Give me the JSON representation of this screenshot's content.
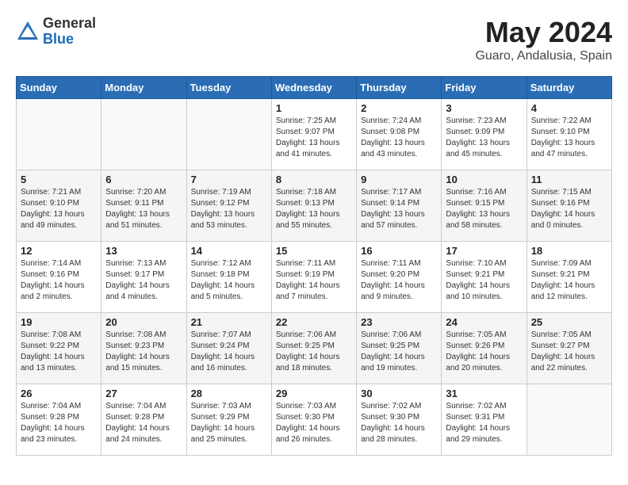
{
  "header": {
    "logo_general": "General",
    "logo_blue": "Blue",
    "month_title": "May 2024",
    "location": "Guaro, Andalusia, Spain"
  },
  "days_of_week": [
    "Sunday",
    "Monday",
    "Tuesday",
    "Wednesday",
    "Thursday",
    "Friday",
    "Saturday"
  ],
  "weeks": [
    [
      {
        "day": "",
        "info": ""
      },
      {
        "day": "",
        "info": ""
      },
      {
        "day": "",
        "info": ""
      },
      {
        "day": "1",
        "info": "Sunrise: 7:25 AM\nSunset: 9:07 PM\nDaylight: 13 hours\nand 41 minutes."
      },
      {
        "day": "2",
        "info": "Sunrise: 7:24 AM\nSunset: 9:08 PM\nDaylight: 13 hours\nand 43 minutes."
      },
      {
        "day": "3",
        "info": "Sunrise: 7:23 AM\nSunset: 9:09 PM\nDaylight: 13 hours\nand 45 minutes."
      },
      {
        "day": "4",
        "info": "Sunrise: 7:22 AM\nSunset: 9:10 PM\nDaylight: 13 hours\nand 47 minutes."
      }
    ],
    [
      {
        "day": "5",
        "info": "Sunrise: 7:21 AM\nSunset: 9:10 PM\nDaylight: 13 hours\nand 49 minutes."
      },
      {
        "day": "6",
        "info": "Sunrise: 7:20 AM\nSunset: 9:11 PM\nDaylight: 13 hours\nand 51 minutes."
      },
      {
        "day": "7",
        "info": "Sunrise: 7:19 AM\nSunset: 9:12 PM\nDaylight: 13 hours\nand 53 minutes."
      },
      {
        "day": "8",
        "info": "Sunrise: 7:18 AM\nSunset: 9:13 PM\nDaylight: 13 hours\nand 55 minutes."
      },
      {
        "day": "9",
        "info": "Sunrise: 7:17 AM\nSunset: 9:14 PM\nDaylight: 13 hours\nand 57 minutes."
      },
      {
        "day": "10",
        "info": "Sunrise: 7:16 AM\nSunset: 9:15 PM\nDaylight: 13 hours\nand 58 minutes."
      },
      {
        "day": "11",
        "info": "Sunrise: 7:15 AM\nSunset: 9:16 PM\nDaylight: 14 hours\nand 0 minutes."
      }
    ],
    [
      {
        "day": "12",
        "info": "Sunrise: 7:14 AM\nSunset: 9:16 PM\nDaylight: 14 hours\nand 2 minutes."
      },
      {
        "day": "13",
        "info": "Sunrise: 7:13 AM\nSunset: 9:17 PM\nDaylight: 14 hours\nand 4 minutes."
      },
      {
        "day": "14",
        "info": "Sunrise: 7:12 AM\nSunset: 9:18 PM\nDaylight: 14 hours\nand 5 minutes."
      },
      {
        "day": "15",
        "info": "Sunrise: 7:11 AM\nSunset: 9:19 PM\nDaylight: 14 hours\nand 7 minutes."
      },
      {
        "day": "16",
        "info": "Sunrise: 7:11 AM\nSunset: 9:20 PM\nDaylight: 14 hours\nand 9 minutes."
      },
      {
        "day": "17",
        "info": "Sunrise: 7:10 AM\nSunset: 9:21 PM\nDaylight: 14 hours\nand 10 minutes."
      },
      {
        "day": "18",
        "info": "Sunrise: 7:09 AM\nSunset: 9:21 PM\nDaylight: 14 hours\nand 12 minutes."
      }
    ],
    [
      {
        "day": "19",
        "info": "Sunrise: 7:08 AM\nSunset: 9:22 PM\nDaylight: 14 hours\nand 13 minutes."
      },
      {
        "day": "20",
        "info": "Sunrise: 7:08 AM\nSunset: 9:23 PM\nDaylight: 14 hours\nand 15 minutes."
      },
      {
        "day": "21",
        "info": "Sunrise: 7:07 AM\nSunset: 9:24 PM\nDaylight: 14 hours\nand 16 minutes."
      },
      {
        "day": "22",
        "info": "Sunrise: 7:06 AM\nSunset: 9:25 PM\nDaylight: 14 hours\nand 18 minutes."
      },
      {
        "day": "23",
        "info": "Sunrise: 7:06 AM\nSunset: 9:25 PM\nDaylight: 14 hours\nand 19 minutes."
      },
      {
        "day": "24",
        "info": "Sunrise: 7:05 AM\nSunset: 9:26 PM\nDaylight: 14 hours\nand 20 minutes."
      },
      {
        "day": "25",
        "info": "Sunrise: 7:05 AM\nSunset: 9:27 PM\nDaylight: 14 hours\nand 22 minutes."
      }
    ],
    [
      {
        "day": "26",
        "info": "Sunrise: 7:04 AM\nSunset: 9:28 PM\nDaylight: 14 hours\nand 23 minutes."
      },
      {
        "day": "27",
        "info": "Sunrise: 7:04 AM\nSunset: 9:28 PM\nDaylight: 14 hours\nand 24 minutes."
      },
      {
        "day": "28",
        "info": "Sunrise: 7:03 AM\nSunset: 9:29 PM\nDaylight: 14 hours\nand 25 minutes."
      },
      {
        "day": "29",
        "info": "Sunrise: 7:03 AM\nSunset: 9:30 PM\nDaylight: 14 hours\nand 26 minutes."
      },
      {
        "day": "30",
        "info": "Sunrise: 7:02 AM\nSunset: 9:30 PM\nDaylight: 14 hours\nand 28 minutes."
      },
      {
        "day": "31",
        "info": "Sunrise: 7:02 AM\nSunset: 9:31 PM\nDaylight: 14 hours\nand 29 minutes."
      },
      {
        "day": "",
        "info": ""
      }
    ]
  ]
}
